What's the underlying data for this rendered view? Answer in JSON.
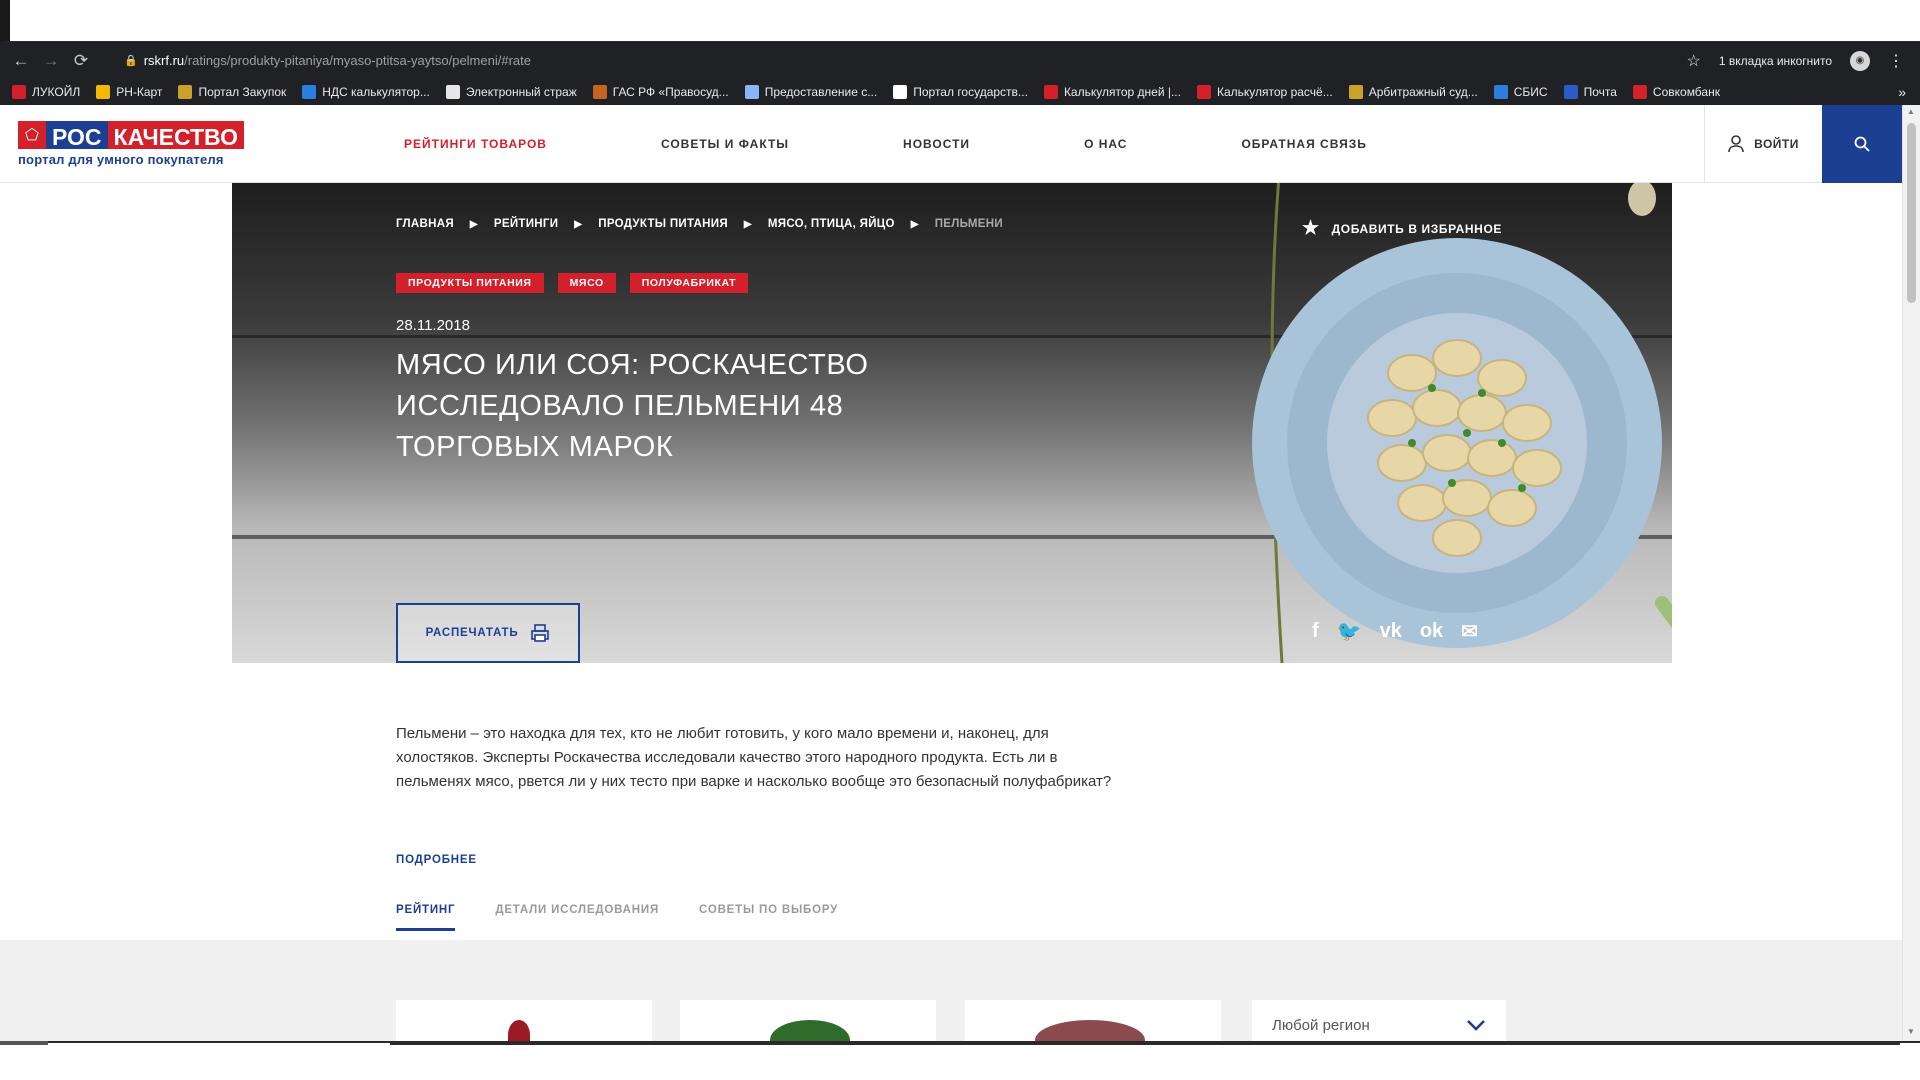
{
  "browser": {
    "url_host": "rskrf.ru",
    "url_path": "/ratings/produkty-pitaniya/myaso-ptitsa-yaytso/pelmeni/#rate",
    "incognito_label": "1 вкладка инкогнито",
    "bookmarks": [
      {
        "label": "ЛУКОЙЛ",
        "color": "#d3202a"
      },
      {
        "label": "РН-Карт",
        "color": "#f5b800"
      },
      {
        "label": "Портал Закупок",
        "color": "#c9a227"
      },
      {
        "label": "НДС калькулятор...",
        "color": "#2a7de1"
      },
      {
        "label": "Электронный страж",
        "color": "#e6e6e6"
      },
      {
        "label": "ГАС РФ «Правосуд...",
        "color": "#c8641e"
      },
      {
        "label": "Предоставление с...",
        "color": "#8ab4f8"
      },
      {
        "label": "Портал государств...",
        "color": "#ffffff"
      },
      {
        "label": "Калькулятор дней |...",
        "color": "#d3202a"
      },
      {
        "label": "Калькулятор расчё...",
        "color": "#d3202a"
      },
      {
        "label": "Арбитражный суд...",
        "color": "#c9a227"
      },
      {
        "label": "СБИС",
        "color": "#2a7de1"
      },
      {
        "label": "Почта",
        "color": "#2a5cc9"
      },
      {
        "label": "Совкомбанк",
        "color": "#d3202a"
      }
    ],
    "more_bookmarks": "»"
  },
  "header": {
    "logo_ros": "РОС",
    "logo_kach": "КАЧЕСТВО",
    "logo_sub": "портал для умного покупателя",
    "nav": [
      {
        "label": "РЕЙТИНГИ ТОВАРОВ",
        "active": true
      },
      {
        "label": "СОВЕТЫ И ФАКТЫ",
        "active": false
      },
      {
        "label": "НОВОСТИ",
        "active": false
      },
      {
        "label": "О НАС",
        "active": false
      },
      {
        "label": "ОБРАТНАЯ СВЯЗЬ",
        "active": false
      }
    ],
    "login_label": "ВОЙТИ"
  },
  "hero": {
    "breadcrumbs": [
      "ГЛАВНАЯ",
      "РЕЙТИНГИ",
      "ПРОДУКТЫ ПИТАНИЯ",
      "МЯСО, ПТИЦА, ЯЙЦО",
      "ПЕЛЬМЕНИ"
    ],
    "favorite_label": "ДОБАВИТЬ В ИЗБРАННОЕ",
    "tags": [
      "ПРОДУКТЫ ПИТАНИЯ",
      "МЯСО",
      "ПОЛУФАБРИКАТ"
    ],
    "date": "28.11.2018",
    "title": "МЯСО ИЛИ СОЯ: РОСКАЧЕСТВО ИССЛЕДОВАЛО ПЕЛЬМЕНИ 48 ТОРГОВЫХ МАРОК",
    "print_label": "РАСПЕЧАТАТЬ",
    "share": [
      {
        "icon": "facebook-icon",
        "glyph": "f"
      },
      {
        "icon": "twitter-icon",
        "glyph": "🐦"
      },
      {
        "icon": "vk-icon",
        "glyph": "vk"
      },
      {
        "icon": "odnoklassniki-icon",
        "glyph": "ok"
      },
      {
        "icon": "mail-icon",
        "glyph": "✉"
      }
    ]
  },
  "content": {
    "intro": "Пельмени – это находка для тех, кто не любит готовить, у кого мало времени и, наконец, для холостяков. Эксперты Роскачества исследовали качество этого народного продукта. Есть ли в пельменях мясо, рвется ли у них тесто при варке и насколько вообще это безопасный полуфабрикат?",
    "more_label": "ПОДРОБНЕЕ",
    "tabs": [
      {
        "label": "РЕЙТИНГ",
        "active": true
      },
      {
        "label": "ДЕТАЛИ ИССЛЕДОВАНИЯ",
        "active": false
      },
      {
        "label": "СОВЕТЫ ПО ВЫБОРУ",
        "active": false
      }
    ],
    "region_select": "Любой регион"
  },
  "colors": {
    "brand_red": "#d3202a",
    "brand_blue": "#1c3f94"
  }
}
